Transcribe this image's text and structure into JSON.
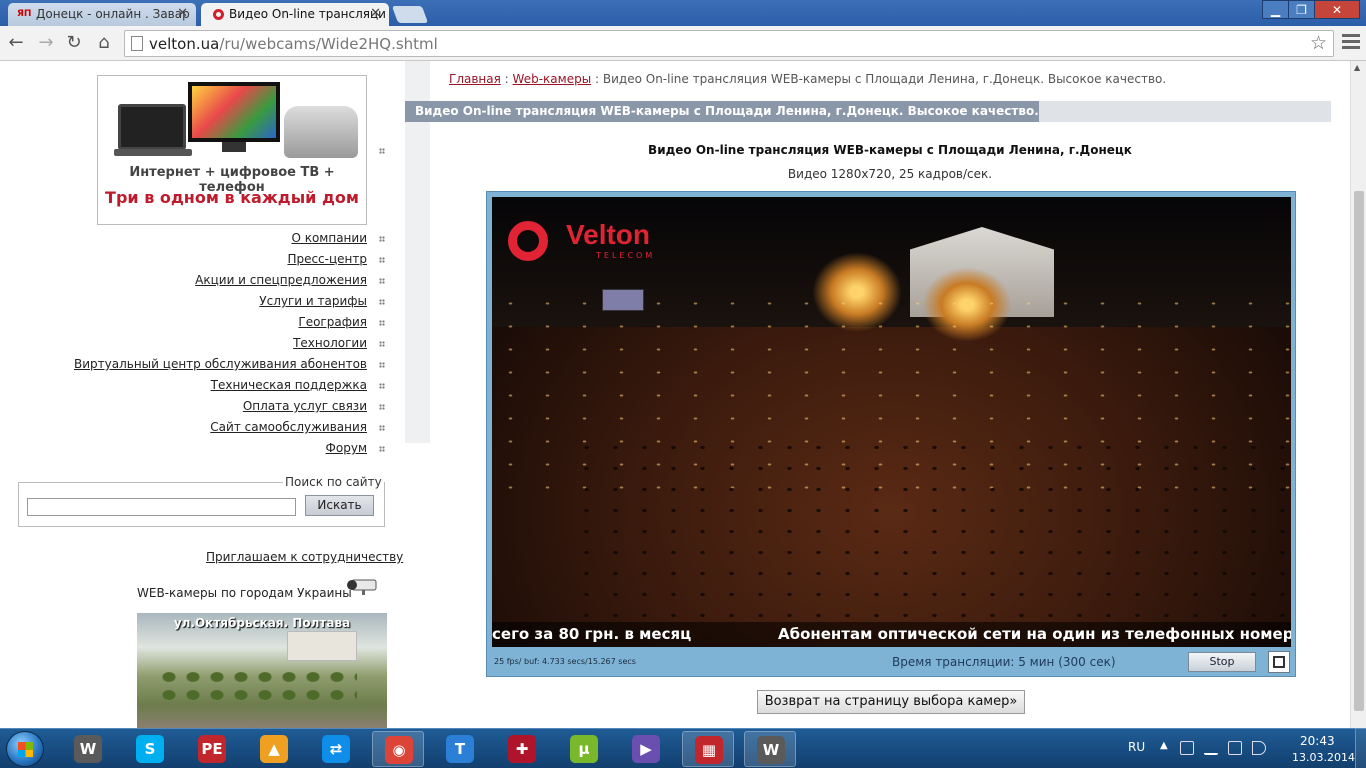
{
  "browser": {
    "tabs": [
      {
        "label": "Донецк - онлайн . Завар",
        "favicon": "ЯП",
        "active": false
      },
      {
        "label": "Видео On-line трансляци",
        "favicon": "velton-logo",
        "active": true
      }
    ],
    "url_host": "velton.ua",
    "url_path": "/ru/webcams/Wide2HQ.shtml",
    "window_buttons": {
      "minimize": "▁",
      "maximize": "❐",
      "close": "✕"
    }
  },
  "banner": {
    "line1": "Интернет + цифровое ТВ + телефон",
    "line2": "Три в одном в каждый дом"
  },
  "left_menu": [
    "О компании",
    "Пресс-центр",
    "Акции и спецпредложения",
    "Услуги и тарифы",
    "География",
    "Технологии",
    "Виртуальный центр обслуживания абонентов",
    "Техническая поддержка",
    "Оплата услуг связи",
    "Сайт самообслуживания",
    "Форум"
  ],
  "search": {
    "legend": "Поиск по сайту",
    "value": "",
    "button": "Искать"
  },
  "cooperation_link": "Приглашаем к сотрудничеству",
  "webcams_cities": "WEB-камеры по городам Украины",
  "city_thumb_caption": "ул.Октябрьская. Полтава",
  "breadcrumb": {
    "home": "Главная",
    "sep": ":",
    "webcams": "Web-камеры",
    "current": "Видео On-line трансляция WEB-камеры с Площади Ленина, г.Донецк. Высокое качество."
  },
  "page_title": "Видео On-line трансляция WEB-камеры с Площади Ленина, г.Донецк. Высокое качество.",
  "video": {
    "heading": "Видео On-line трансляция WEB-камеры с Площади Ленина, г.Донецк",
    "subheading": "Видео 1280x720, 25 кадров/сек.",
    "logo_text": "Velton",
    "logo_sub": "TELECOM",
    "ticker_left": "сего за 80 грн. в месяц",
    "ticker_right": "Абонентам оптической сети на один из телефонных номеров",
    "fps_info": "25 fps/ buf: 4.733 secs/15.267 secs",
    "broadcast_time": "Время трансляции: 5 мин (300 сек)",
    "stop_button": "Stop"
  },
  "back_button": "Возврат на страницу выбора камер»",
  "taskbar": {
    "apps": [
      {
        "name": "world-of-tanks",
        "glyph": "W",
        "color": "#5a5a5a",
        "open": false
      },
      {
        "name": "skype",
        "glyph": "S",
        "color": "#00aff0",
        "open": false
      },
      {
        "name": "pe-explorer",
        "glyph": "PE",
        "color": "#c0262c",
        "open": false
      },
      {
        "name": "aimp",
        "glyph": "▲",
        "color": "#f0a020",
        "open": false
      },
      {
        "name": "teamviewer",
        "glyph": "⇄",
        "color": "#0e8ee9",
        "open": false
      },
      {
        "name": "chrome",
        "glyph": "◉",
        "color": "#db4437",
        "open": true
      },
      {
        "name": "tools",
        "glyph": "T",
        "color": "#2b7fd6",
        "open": false
      },
      {
        "name": "antivirus",
        "glyph": "✚",
        "color": "#b0142a",
        "open": false
      },
      {
        "name": "utorrent",
        "glyph": "µ",
        "color": "#78b82a",
        "open": false
      },
      {
        "name": "visual-studio",
        "glyph": "▶",
        "color": "#6a4fb0",
        "open": false
      },
      {
        "name": "save-app",
        "glyph": "▦",
        "color": "#c0262c",
        "open": true
      },
      {
        "name": "world-of-tanks-2",
        "glyph": "W",
        "color": "#5a5a5a",
        "open": true
      }
    ],
    "lang": "RU",
    "time": "20:43",
    "date": "13.03.2014"
  }
}
